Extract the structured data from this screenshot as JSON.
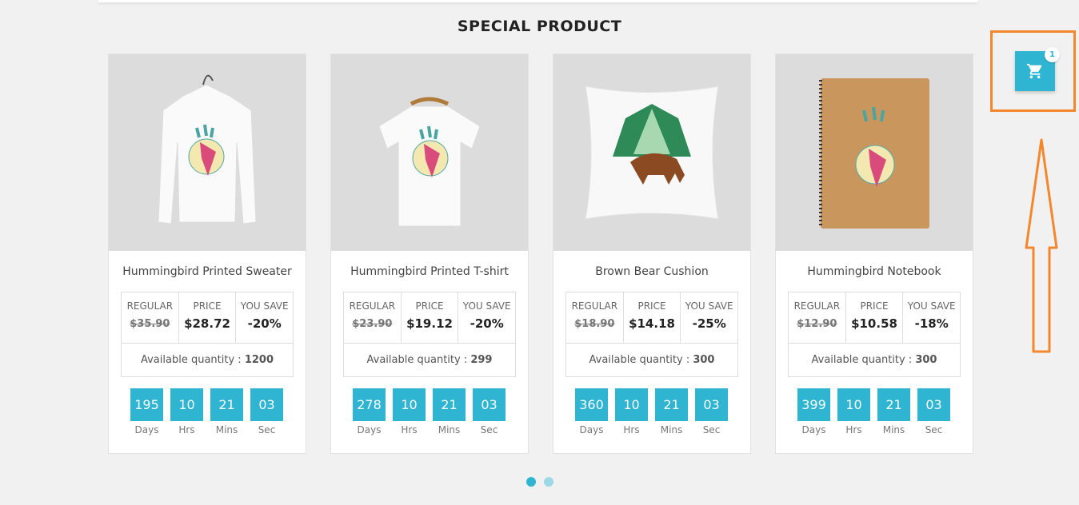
{
  "section": {
    "title": "SPECIAL PRODUCT"
  },
  "labels": {
    "regular": "REGULAR",
    "price": "PRICE",
    "you_save": "YOU SAVE",
    "available": "Available quantity : "
  },
  "countdown_labels": [
    "Days",
    "Hrs",
    "Mins",
    "Sec"
  ],
  "products": [
    {
      "name": "Hummingbird Printed Sweater",
      "regular": "$35.90",
      "price": "$28.72",
      "save": "-20%",
      "qty": "1200",
      "days": "195",
      "hrs": "10",
      "mins": "21",
      "sec": "03",
      "image_icon": "sweater-image"
    },
    {
      "name": "Hummingbird Printed T-shirt",
      "regular": "$23.90",
      "price": "$19.12",
      "save": "-20%",
      "qty": "299",
      "days": "278",
      "hrs": "10",
      "mins": "21",
      "sec": "03",
      "image_icon": "tshirt-image"
    },
    {
      "name": "Brown Bear Cushion",
      "regular": "$18.90",
      "price": "$14.18",
      "save": "-25%",
      "qty": "300",
      "days": "360",
      "hrs": "10",
      "mins": "21",
      "sec": "03",
      "image_icon": "cushion-image"
    },
    {
      "name": "Hummingbird Notebook",
      "regular": "$12.90",
      "price": "$10.58",
      "save": "-18%",
      "qty": "300",
      "days": "399",
      "hrs": "10",
      "mins": "21",
      "sec": "03",
      "image_icon": "notebook-image"
    }
  ],
  "cart": {
    "count": "1",
    "icon": "cart-icon"
  },
  "carousel": {
    "pages": 2,
    "active": 1
  },
  "colors": {
    "accent": "#2fb5d2",
    "annotation": "#f4862b"
  }
}
